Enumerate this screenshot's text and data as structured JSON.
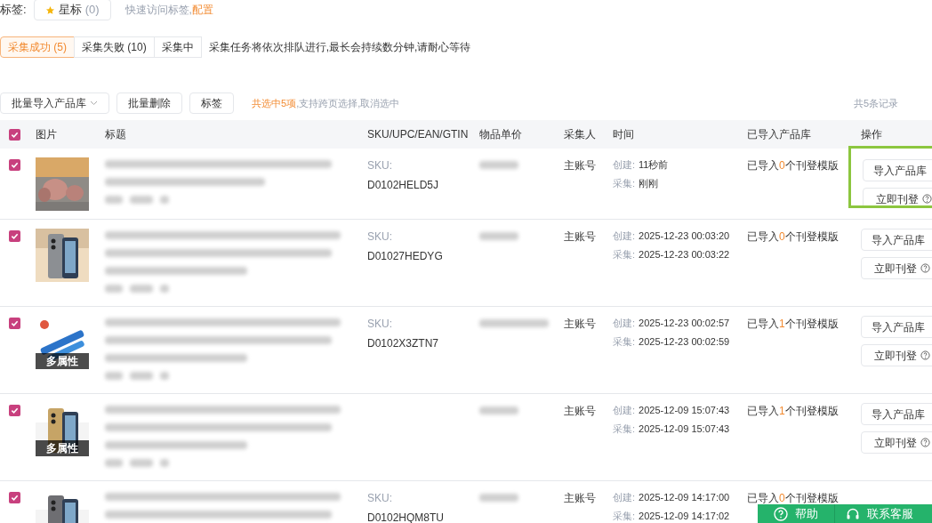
{
  "tags_bar": {
    "label": "标签:",
    "star_tag": {
      "label": "星标",
      "count": "(0)"
    },
    "hint": "快速访问标签,",
    "config_link": "配置"
  },
  "tabs": [
    {
      "label": "采集成功",
      "count": "(5)",
      "selected": true
    },
    {
      "label": "采集失败",
      "count": "(10)",
      "selected": false
    },
    {
      "label": "采集中",
      "selected": false
    }
  ],
  "notice": "采集任务将依次排队进行,最长会持续数分钟,请耐心等待",
  "toolbar": {
    "buttons": [
      {
        "label": "批量导入产品库",
        "kind": "dropdown"
      },
      {
        "label": "批量删除",
        "kind": "plain"
      },
      {
        "label": "标签",
        "kind": "plain"
      }
    ],
    "selection_count": "共选中5项",
    "selection_hint": ",支持跨页选择,",
    "cancel_link": "取消选中",
    "total": "共5条记录"
  },
  "table": {
    "all_checked": true,
    "columns": [
      "图片",
      "标题",
      "SKU/UPC/EAN/GTIN",
      "物品单价",
      "采集人",
      "时间",
      "已导入产品库",
      "操作"
    ],
    "rows": [
      {
        "checked": true,
        "sku_label": "SKU:",
        "sku": "D0102HELD5J",
        "collector": "主账号",
        "created_label": "创建:",
        "created": "11秒前",
        "collected_label": "采集:",
        "collected": "刚刚",
        "imported_pre": "已导入",
        "imported_count": "0",
        "imported_post": "个刊登模版",
        "highlighted": true,
        "actions": [
          "导入产品库",
          "立即刊登"
        ]
      },
      {
        "checked": true,
        "sku_label": "SKU:",
        "sku": "D01027HEDYG",
        "collector": "主账号",
        "created_label": "创建:",
        "created": "2025-12-23 00:03:20",
        "collected_label": "采集:",
        "collected": "2025-12-23 00:03:22",
        "imported_pre": "已导入",
        "imported_count": "0",
        "imported_post": "个刊登模版",
        "highlighted": false,
        "actions": [
          "导入产品库",
          "立即刊登"
        ]
      },
      {
        "checked": true,
        "multi_attr": "多属性",
        "sku_label": "SKU:",
        "sku": "D0102X3ZTN7",
        "collector": "主账号",
        "created_label": "创建:",
        "created": "2025-12-23 00:02:57",
        "collected_label": "采集:",
        "collected": "2025-12-23 00:02:59",
        "imported_pre": "已导入",
        "imported_count": "1",
        "imported_post": "个刊登模版",
        "highlighted": false,
        "actions": [
          "导入产品库",
          "立即刊登"
        ]
      },
      {
        "checked": true,
        "multi_attr": "多属性",
        "collector": "主账号",
        "created_label": "创建:",
        "created": "2025-12-09 15:07:43",
        "collected_label": "采集:",
        "collected": "2025-12-09 15:07:43",
        "imported_pre": "已导入",
        "imported_count": "1",
        "imported_post": "个刊登模版",
        "highlighted": false,
        "actions": [
          "导入产品库",
          "立即刊登"
        ]
      },
      {
        "checked": true,
        "sku_label": "SKU:",
        "sku": "D0102HQM8TU",
        "collector": "主账号",
        "created_label": "创建:",
        "created": "2025-12-09 14:17:00",
        "collected_label": "采集:",
        "collected": "2025-12-09 14:17:02",
        "imported_pre": "已导入",
        "imported_count": "0",
        "imported_post": "个刊登模版",
        "highlighted": false
      }
    ]
  },
  "help_bar": {
    "help": "帮助",
    "contact": "联系客服"
  }
}
